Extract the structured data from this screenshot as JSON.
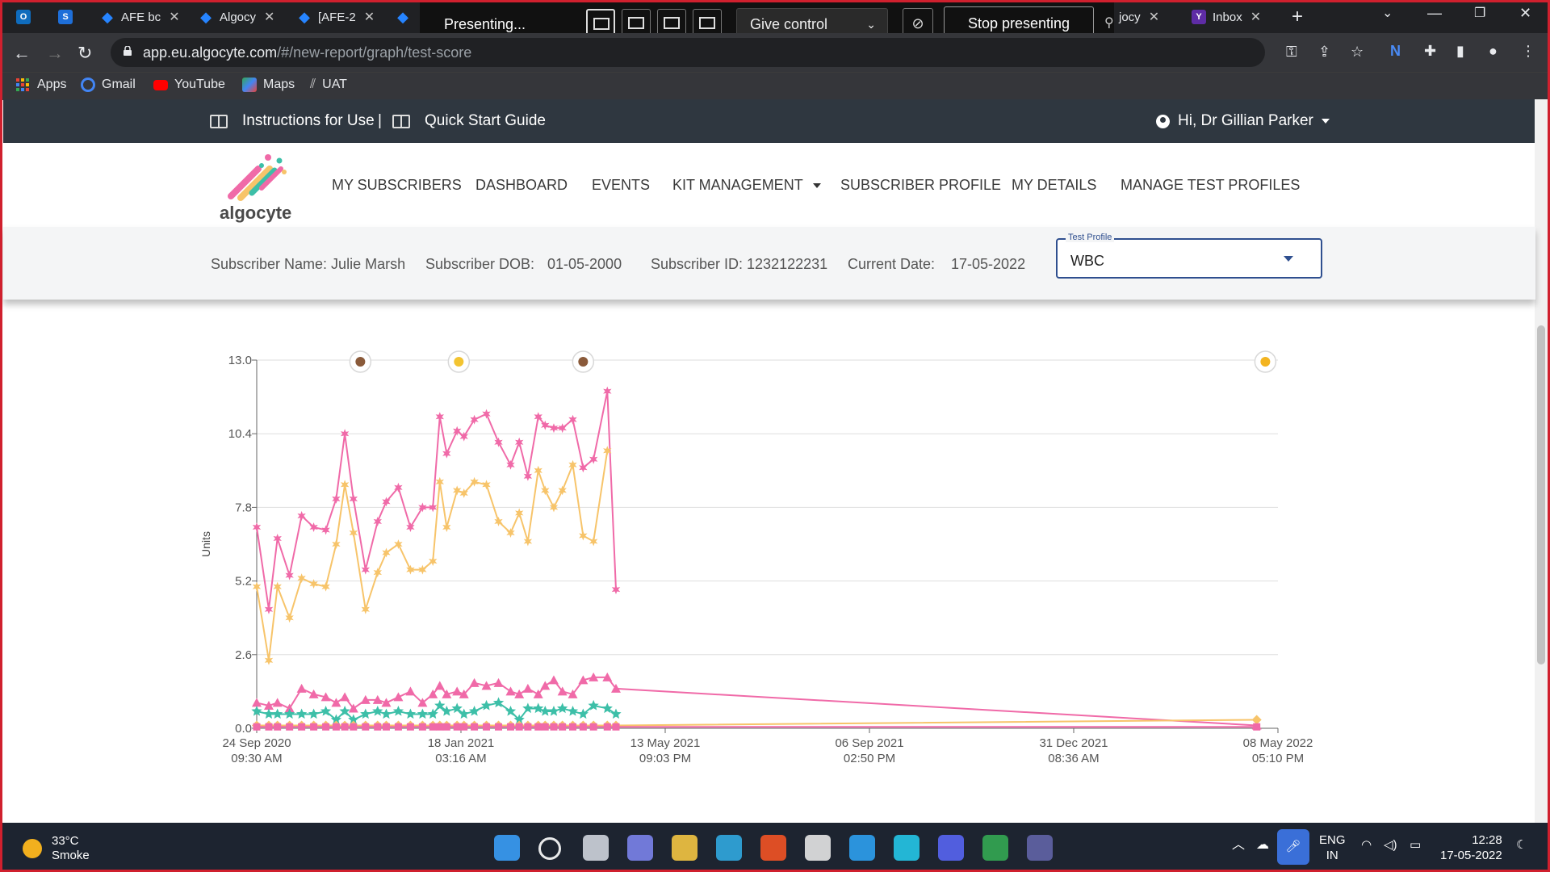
{
  "browser": {
    "tabs": [
      {
        "label": "",
        "color": "#0f6cbd",
        "glyph": "O"
      },
      {
        "label": "",
        "color": "#1e6fd9",
        "glyph": "S"
      },
      {
        "label": "AFE bc",
        "color": "#2684ff",
        "glyph": "◆"
      },
      {
        "label": "Algocy",
        "color": "#2684ff",
        "glyph": "◆"
      },
      {
        "label": "[AFE-2",
        "color": "#2684ff",
        "glyph": "◆"
      },
      {
        "label": "",
        "color": "#2684ff",
        "glyph": "◆"
      },
      {
        "label": "jocy",
        "color": "#2684ff",
        "glyph": ""
      },
      {
        "label": "Inbox",
        "color": "#5e2ca5",
        "glyph": "Y"
      }
    ],
    "presenting_label": "Presenting...",
    "give_control_label": "Give control",
    "stop_presenting_label": "Stop presenting",
    "url_host": "app.eu.algocyte.com",
    "url_path": "/#/new-report/graph/test-score",
    "bookmarks": [
      {
        "label": "Apps",
        "color": "#ea4335"
      },
      {
        "label": "Gmail",
        "color": "#ffffff"
      },
      {
        "label": "YouTube",
        "color": "#ff0000"
      },
      {
        "label": "Maps",
        "color": "#34a853"
      },
      {
        "label": "UAT",
        "color": "#aaaaaa"
      }
    ]
  },
  "header": {
    "instructions_label": "Instructions for Use",
    "separator": "|",
    "quick_start_label": "Quick Start Guide",
    "greeting": "Hi, Dr Gillian Parker"
  },
  "logo_text": "algocyte",
  "nav": [
    {
      "label": "MY SUBSCRIBERS"
    },
    {
      "label": "DASHBOARD"
    },
    {
      "label": "EVENTS"
    },
    {
      "label": "KIT MANAGEMENT"
    },
    {
      "label": "SUBSCRIBER PROFILE"
    },
    {
      "label": "MY DETAILS"
    },
    {
      "label": "MANAGE TEST PROFILES"
    }
  ],
  "subscriber": {
    "name": "Subscriber Name: Julie Marsh",
    "dob_label": "Subscriber DOB:",
    "dob": "01-05-2000",
    "id": "Subscriber ID: 1232122231",
    "current_date_label": "Current Date:",
    "current_date": "17-05-2022"
  },
  "test_profile": {
    "label": "Test Profile",
    "value": "WBC"
  },
  "chart_data": {
    "type": "line",
    "ylabel": "Units",
    "ylim": [
      0,
      13
    ],
    "yticks": [
      "0.0",
      "2.6",
      "5.2",
      "7.8",
      "10.4",
      "13.0"
    ],
    "xticks": [
      {
        "date": "24 Sep 2020",
        "time": "09:30 AM"
      },
      {
        "date": "18 Jan 2021",
        "time": "03:16 AM"
      },
      {
        "date": "13 May 2021",
        "time": "09:03 PM"
      },
      {
        "date": "06 Sep 2021",
        "time": "02:50 PM"
      },
      {
        "date": "31 Dec 2021",
        "time": "08:36 AM"
      },
      {
        "date": "08 May 2022",
        "time": "05:10 PM"
      }
    ],
    "x_span_days": 591.3,
    "events": [
      {
        "name": "syringe-icon",
        "day": 60,
        "color": "#8a5a3a"
      },
      {
        "name": "note-icon",
        "day": 117,
        "color": "#f3c431"
      },
      {
        "name": "cutlery-icon",
        "day": 189,
        "color": "#8a5a3a"
      },
      {
        "name": "hazard-icon",
        "day": 584,
        "color": "#f3b420"
      }
    ],
    "series": [
      {
        "marker": "asterisk",
        "color": "#f06aa8",
        "x": [
          0,
          7,
          12,
          19,
          26,
          33,
          40,
          46,
          51,
          56,
          63,
          70,
          75,
          82,
          89,
          96,
          102,
          106,
          110,
          116,
          120,
          126,
          133,
          140,
          147,
          152,
          157,
          163,
          167,
          172,
          177,
          183,
          189,
          195,
          203,
          208
        ],
        "values": [
          7.1,
          4.2,
          6.7,
          5.4,
          7.5,
          7.1,
          7.0,
          8.1,
          10.4,
          8.1,
          5.6,
          7.3,
          8.0,
          8.5,
          7.1,
          7.8,
          7.8,
          11.0,
          9.7,
          10.5,
          10.3,
          10.9,
          11.1,
          10.1,
          9.3,
          10.1,
          8.9,
          11.0,
          10.7,
          10.6,
          10.6,
          10.9,
          9.2,
          9.5,
          11.9,
          4.9
        ]
      },
      {
        "marker": "asterisk",
        "color": "#f7c46a",
        "x": [
          0,
          7,
          12,
          19,
          26,
          33,
          40,
          46,
          51,
          56,
          63,
          70,
          75,
          82,
          89,
          96,
          102,
          106,
          110,
          116,
          120,
          126,
          133,
          140,
          147,
          152,
          157,
          163,
          167,
          172,
          177,
          183,
          189,
          195,
          203
        ],
        "values": [
          5.0,
          2.4,
          5.0,
          3.9,
          5.3,
          5.1,
          5.0,
          6.5,
          8.6,
          6.9,
          4.2,
          5.5,
          6.2,
          6.5,
          5.6,
          5.6,
          5.9,
          8.7,
          7.1,
          8.4,
          8.3,
          8.7,
          8.6,
          7.3,
          6.9,
          7.6,
          6.6,
          9.1,
          8.4,
          7.8,
          8.4,
          9.3,
          6.8,
          6.6,
          9.8
        ]
      },
      {
        "marker": "triangle",
        "color": "#f06aa8",
        "x": [
          0,
          7,
          12,
          19,
          26,
          33,
          40,
          46,
          51,
          56,
          63,
          70,
          75,
          82,
          89,
          96,
          102,
          106,
          110,
          116,
          120,
          126,
          133,
          140,
          147,
          152,
          157,
          163,
          167,
          172,
          177,
          183,
          189,
          195,
          203,
          208,
          579
        ],
        "values": [
          0.9,
          0.8,
          0.9,
          0.7,
          1.4,
          1.2,
          1.1,
          0.9,
          1.1,
          0.7,
          1.0,
          1.0,
          0.9,
          1.1,
          1.3,
          0.9,
          1.2,
          1.5,
          1.2,
          1.3,
          1.2,
          1.6,
          1.5,
          1.6,
          1.3,
          1.2,
          1.4,
          1.2,
          1.5,
          1.7,
          1.3,
          1.2,
          1.7,
          1.8,
          1.8,
          1.4,
          0.1
        ]
      },
      {
        "marker": "star",
        "color": "#3dbfa8",
        "x": [
          0,
          7,
          12,
          19,
          26,
          33,
          40,
          46,
          51,
          56,
          63,
          70,
          75,
          82,
          89,
          96,
          102,
          106,
          110,
          116,
          120,
          126,
          133,
          140,
          147,
          152,
          157,
          163,
          167,
          172,
          177,
          183,
          189,
          195,
          203,
          208
        ],
        "values": [
          0.6,
          0.5,
          0.5,
          0.5,
          0.5,
          0.5,
          0.6,
          0.3,
          0.6,
          0.3,
          0.5,
          0.6,
          0.5,
          0.6,
          0.5,
          0.5,
          0.5,
          0.8,
          0.6,
          0.7,
          0.5,
          0.6,
          0.8,
          0.9,
          0.6,
          0.3,
          0.7,
          0.7,
          0.6,
          0.6,
          0.7,
          0.6,
          0.5,
          0.8,
          0.7,
          0.5
        ]
      },
      {
        "marker": "diamond",
        "color": "#f7c46a",
        "x": [
          0,
          7,
          12,
          19,
          26,
          33,
          40,
          46,
          51,
          56,
          63,
          70,
          75,
          82,
          89,
          96,
          102,
          106,
          110,
          116,
          120,
          126,
          133,
          140,
          147,
          152,
          157,
          163,
          167,
          172,
          177,
          183,
          189,
          195,
          203,
          208,
          579
        ],
        "values": [
          0.1,
          0.1,
          0.1,
          0.1,
          0.1,
          0.1,
          0.1,
          0.1,
          0.1,
          0.1,
          0.1,
          0.1,
          0.1,
          0.1,
          0.1,
          0.1,
          0.1,
          0.1,
          0.1,
          0.1,
          0.1,
          0.1,
          0.1,
          0.1,
          0.1,
          0.1,
          0.1,
          0.1,
          0.1,
          0.1,
          0.1,
          0.1,
          0.1,
          0.1,
          0.1,
          0.1,
          0.3
        ]
      },
      {
        "marker": "square",
        "color": "#f06aa8",
        "x": [
          0,
          7,
          12,
          19,
          26,
          33,
          40,
          46,
          51,
          56,
          63,
          70,
          75,
          82,
          89,
          96,
          102,
          106,
          110,
          116,
          120,
          126,
          133,
          140,
          147,
          152,
          157,
          163,
          167,
          172,
          177,
          183,
          189,
          195,
          203,
          208,
          579
        ],
        "values": [
          0.05,
          0.05,
          0.05,
          0.05,
          0.05,
          0.05,
          0.05,
          0.05,
          0.05,
          0.05,
          0.05,
          0.05,
          0.05,
          0.05,
          0.05,
          0.05,
          0.05,
          0.05,
          0.05,
          0.05,
          0.05,
          0.05,
          0.05,
          0.05,
          0.05,
          0.05,
          0.05,
          0.05,
          0.05,
          0.05,
          0.05,
          0.05,
          0.05,
          0.05,
          0.05,
          0.05,
          0.05
        ]
      }
    ]
  },
  "taskbar": {
    "temperature": "33°C",
    "condition": "Smoke",
    "language": "ENG",
    "region": "IN",
    "time": "12:28",
    "date": "17-05-2022",
    "apps": [
      {
        "name": "start-icon",
        "color": "#3a9df7"
      },
      {
        "name": "search-icon",
        "color": "#ffffff"
      },
      {
        "name": "task-view-icon",
        "color": "#cfd4dd"
      },
      {
        "name": "chat-icon",
        "color": "#7b83eb"
      },
      {
        "name": "file-explorer-icon",
        "color": "#f4c542"
      },
      {
        "name": "edge-icon",
        "color": "#31a8e0"
      },
      {
        "name": "store-icon",
        "color": "#f35325"
      },
      {
        "name": "app-icon",
        "color": "#e6e6e6"
      },
      {
        "name": "help-icon",
        "color": "#2ea0f0"
      },
      {
        "name": "alexa-icon",
        "color": "#25c7e8"
      },
      {
        "name": "discord-icon",
        "color": "#5865f2"
      },
      {
        "name": "chrome-icon",
        "color": "#34a853"
      },
      {
        "name": "teams-icon",
        "color": "#6264a7"
      }
    ]
  }
}
